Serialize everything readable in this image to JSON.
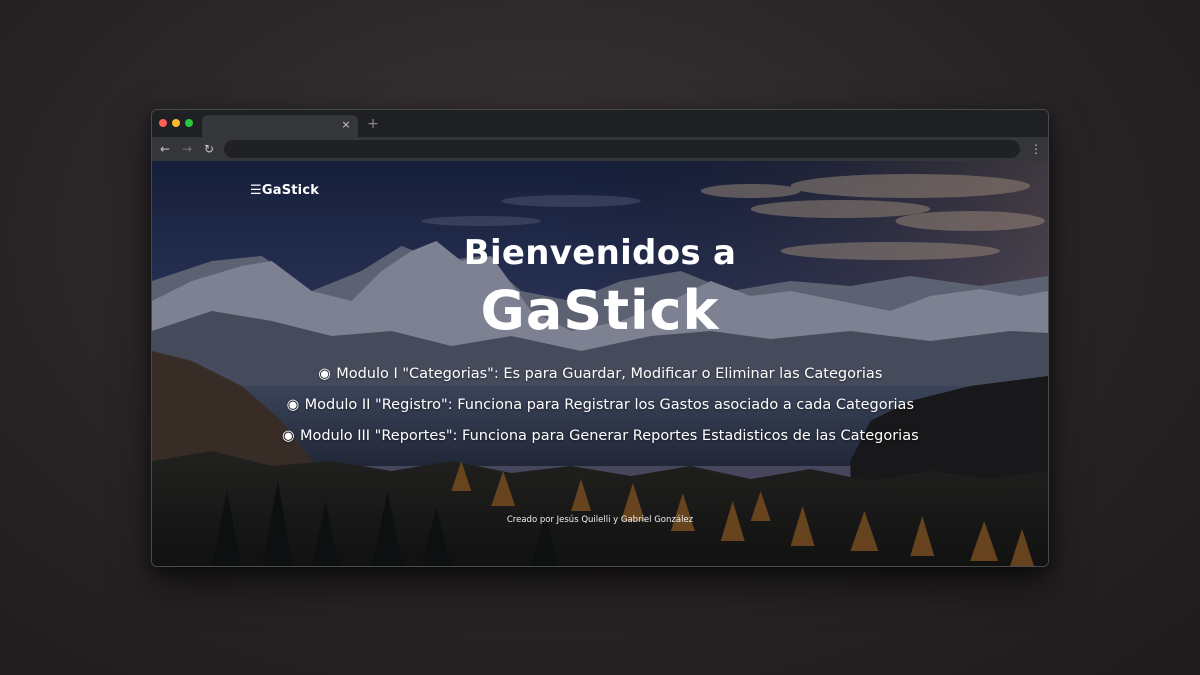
{
  "browser": {
    "tab_close_icon": "×",
    "new_tab_icon": "+",
    "back_icon": "←",
    "forward_icon": "→",
    "reload_icon": "↻",
    "menu_icon": "⋮",
    "url": ""
  },
  "page": {
    "brand": "☰GaStick",
    "headline": "Bienvenidos a",
    "title": "GaStick",
    "modules": [
      {
        "bullet": "◉",
        "text": "Modulo I \"Categorias\": Es para Guardar, Modificar o Eliminar las Categorias"
      },
      {
        "bullet": "◉",
        "text": "Modulo II \"Registro\": Funciona para Registrar los Gastos asociado a cada Categorias"
      },
      {
        "bullet": "◉",
        "text": "Modulo III \"Reportes\": Funciona para Generar Reportes Estadisticos de las Categorias"
      }
    ],
    "credit": "Creado por Jesús Quilelli y Gabriel González"
  },
  "colors": {
    "traffic_red": "#ff5f57",
    "traffic_yellow": "#febc2e",
    "traffic_green": "#28c840",
    "text": "#ffffff"
  }
}
